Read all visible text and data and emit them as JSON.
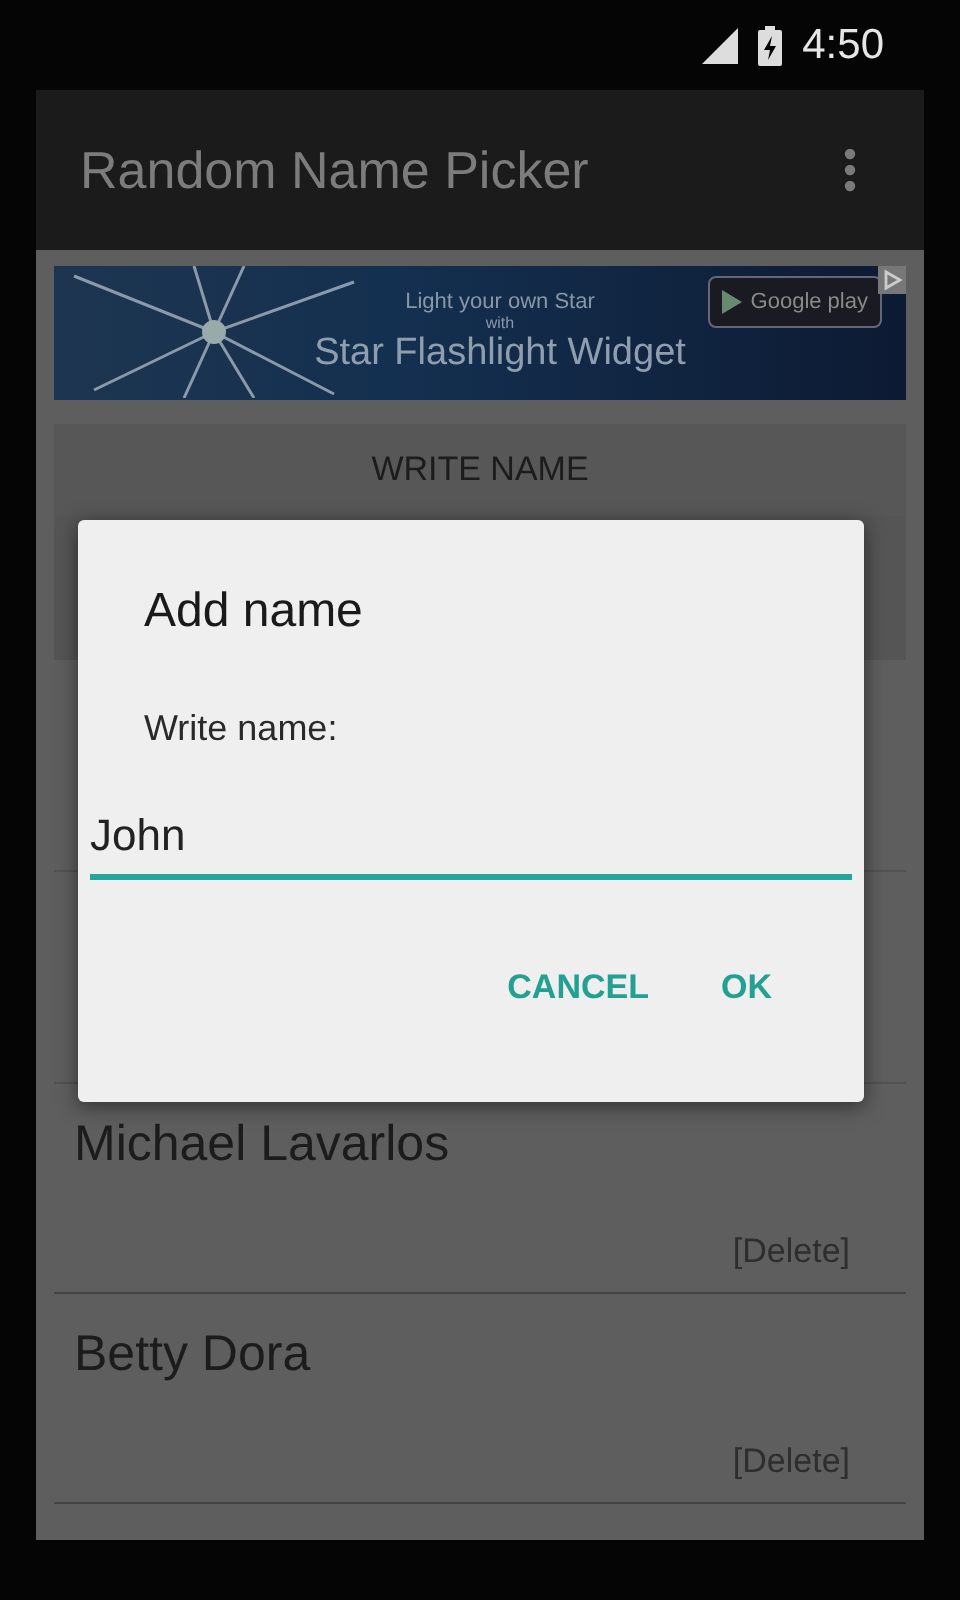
{
  "status_bar": {
    "time": "4:50"
  },
  "app_bar": {
    "title": "Random Name Picker"
  },
  "ad_banner": {
    "line_1": "Light your own Star",
    "line_2": "with",
    "line_3": "Star Flashlight Widget",
    "store_badge": "Google play"
  },
  "write_name_button": "WRITE NAME",
  "names": [
    {
      "name": "Michael Lavarlos",
      "action": "[Delete]"
    },
    {
      "name": "Betty Dora",
      "action": "[Delete]"
    }
  ],
  "dialog": {
    "title": "Add name",
    "label": "Write name:",
    "value": "John",
    "buttons": [
      "CANCEL",
      "OK"
    ]
  }
}
